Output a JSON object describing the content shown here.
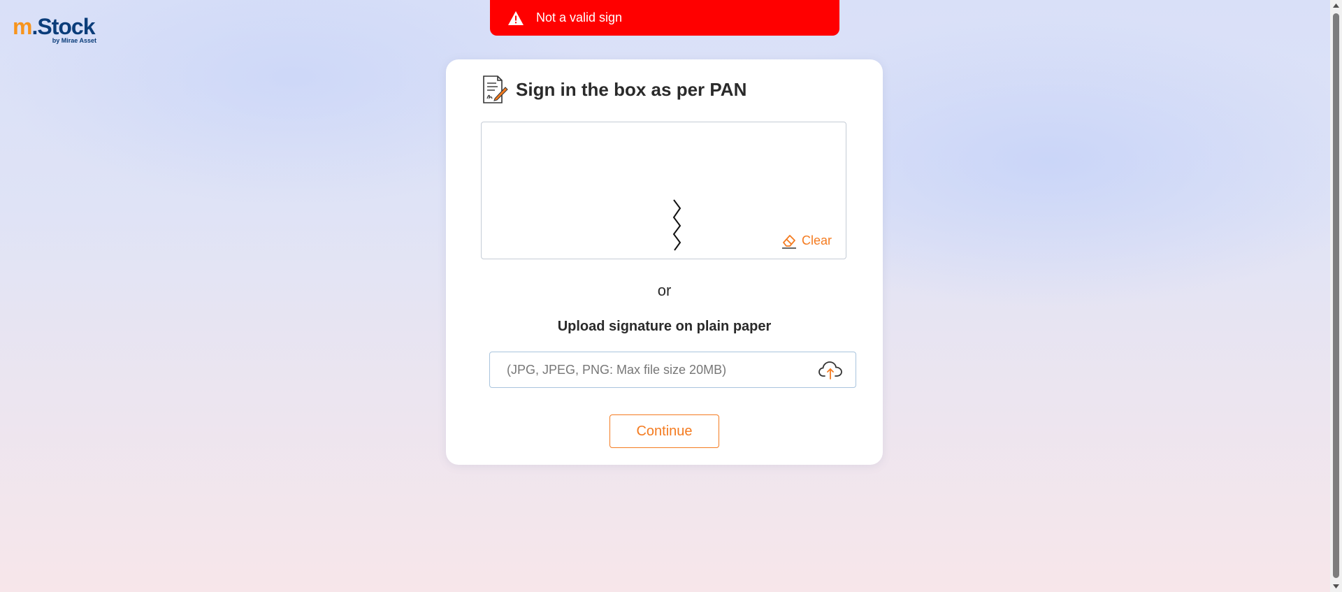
{
  "brand": {
    "logo_m": "m",
    "logo_stock": ".Stock",
    "logo_sub": "by Mirae Asset",
    "colors": {
      "orange": "#f7941d",
      "navy": "#0b3d7a"
    }
  },
  "toast": {
    "message": "Not a valid sign",
    "icon": "warning-icon",
    "color": "#ff0000"
  },
  "card": {
    "title": "Sign in the box as per PAN",
    "title_icon": "document-sign-icon",
    "clear_label": "Clear",
    "clear_icon": "eraser-icon",
    "or_text": "or",
    "upload_title": "Upload signature on plain paper",
    "upload_placeholder": "(JPG, JPEG, PNG: Max file size 20MB)",
    "upload_icon": "cloud-upload-icon",
    "continue_label": "Continue",
    "accent_color": "#f47b20"
  }
}
